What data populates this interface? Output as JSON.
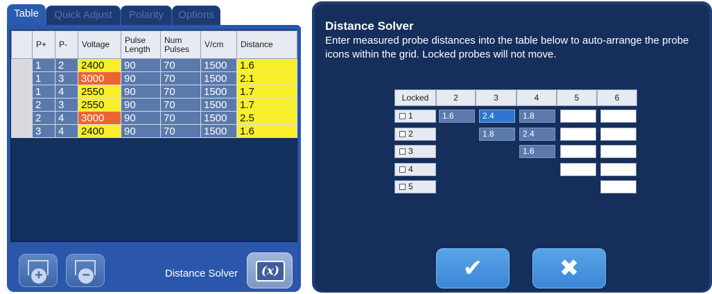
{
  "tabs": [
    "Table",
    "Quick Adjust",
    "Polarity",
    "Options"
  ],
  "table": {
    "headers": [
      "",
      "P+",
      "P-",
      "Voltage",
      "Pulse Length",
      "Num Pulses",
      "V/cm",
      "Distance"
    ],
    "rows": [
      {
        "p_plus": "1",
        "p_minus": "2",
        "voltage": "2400",
        "voltage_color": "yellow",
        "pulse_length": "90",
        "num_pulses": "70",
        "v_cm": "1500",
        "distance": "1.6"
      },
      {
        "p_plus": "1",
        "p_minus": "3",
        "voltage": "3000",
        "voltage_color": "orange",
        "pulse_length": "90",
        "num_pulses": "70",
        "v_cm": "1500",
        "distance": "2.1"
      },
      {
        "p_plus": "1",
        "p_minus": "4",
        "voltage": "2550",
        "voltage_color": "yellow",
        "pulse_length": "90",
        "num_pulses": "70",
        "v_cm": "1500",
        "distance": "1.7"
      },
      {
        "p_plus": "2",
        "p_minus": "3",
        "voltage": "2550",
        "voltage_color": "yellow",
        "pulse_length": "90",
        "num_pulses": "70",
        "v_cm": "1500",
        "distance": "1.7"
      },
      {
        "p_plus": "2",
        "p_minus": "4",
        "voltage": "3000",
        "voltage_color": "orange",
        "pulse_length": "90",
        "num_pulses": "70",
        "v_cm": "1500",
        "distance": "2.5"
      },
      {
        "p_plus": "3",
        "p_minus": "4",
        "voltage": "2400",
        "voltage_color": "yellow",
        "pulse_length": "90",
        "num_pulses": "70",
        "v_cm": "1500",
        "distance": "1.6"
      }
    ]
  },
  "bottom": {
    "add_icon": "add-probe-icon",
    "remove_icon": "remove-probe-icon",
    "distance_solver_label": "Distance Solver",
    "distance_solver_icon_text": "(x)"
  },
  "dialog": {
    "title": "Distance Solver",
    "instructions": "Enter measured probe distances into the table below to auto-arrange the probe icons within the grid.  Locked probes will not move.",
    "headers": [
      "Locked",
      "2",
      "3",
      "4",
      "5",
      "6"
    ],
    "lock_labels": [
      "1",
      "2",
      "3",
      "4",
      "5"
    ],
    "cells": {
      "r1c2": "1.6",
      "r1c3": "2.4",
      "r1c4": "1.8",
      "r2c3": "1.8",
      "r2c4": "2.4",
      "r3c4": "1.6"
    },
    "ok_glyph": "✔",
    "cancel_glyph": "✖"
  },
  "colors": {
    "yellow": "#f8ef2a",
    "orange": "#ec6530",
    "panel_blue": "#2a56ab",
    "dialog_bg": "#152e5b",
    "button_blue": "#3b86d6"
  }
}
